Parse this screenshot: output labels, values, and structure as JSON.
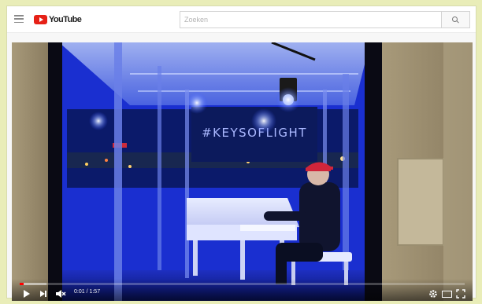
{
  "masthead": {
    "logo_text": "YouTube",
    "search": {
      "placeholder": "Zoeken",
      "value": ""
    },
    "icons": [
      "menu-icon",
      "youtube-logo-icon",
      "search-icon"
    ]
  },
  "video": {
    "sign_text": "#KEYSOFLIGHT",
    "elapsed": "0:01",
    "duration": "1:57",
    "time_display": "0:01 / 1:57",
    "progress_played": 0.009,
    "progress_loaded": 0.06,
    "controls": [
      "play-icon",
      "next-icon",
      "mute-icon",
      "settings-icon",
      "theater-icon",
      "fullscreen-icon"
    ]
  },
  "colors": {
    "page_background": "#e9edb8",
    "accent_red": "#e62117",
    "progress_red": "#ff0000",
    "scene_blue": "#1a2fd0",
    "cap_red": "#d0253a"
  }
}
